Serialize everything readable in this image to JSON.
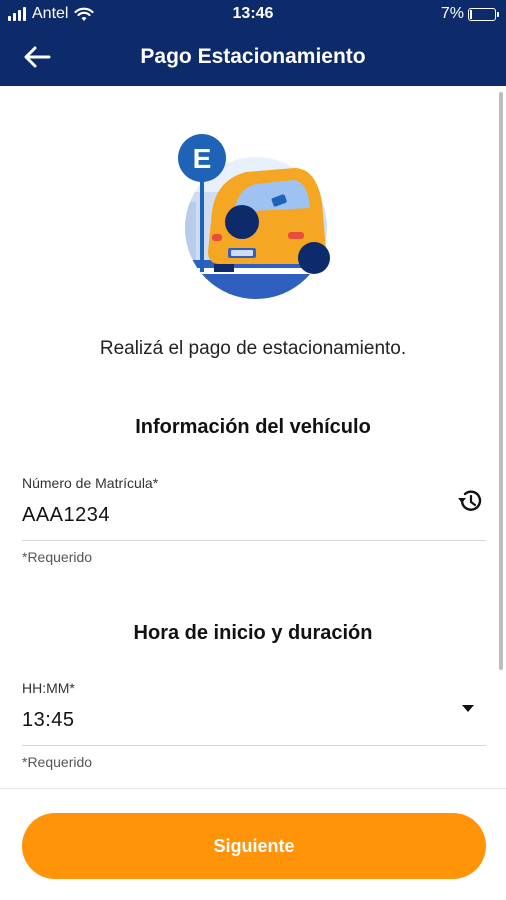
{
  "status_bar": {
    "carrier": "Antel",
    "time": "13:46",
    "battery": "7%",
    "battery_level": 0.07
  },
  "app_bar": {
    "back_icon": "arrow-left-icon",
    "title": "Pago Estacionamiento"
  },
  "hero": {
    "sign_letter": "E"
  },
  "intro_text": "Realizá el pago de estacionamiento.",
  "vehicle_section": {
    "title": "Información del vehículo",
    "plate_field": {
      "label": "Número de Matrícula*",
      "value": "AAA1234",
      "helper": "*Requerido",
      "icon": "history-icon"
    }
  },
  "time_section": {
    "title": "Hora de inicio y duración",
    "time_field": {
      "label": "HH:MM*",
      "value": "13:45",
      "helper": "*Requerido",
      "icon": "dropdown-arrow-icon"
    }
  },
  "next_button": {
    "label": "Siguiente"
  },
  "colors": {
    "header": "#0d2a6b",
    "accent": "#ff9409",
    "sign": "#1e63b8",
    "car": "#f5a623"
  }
}
